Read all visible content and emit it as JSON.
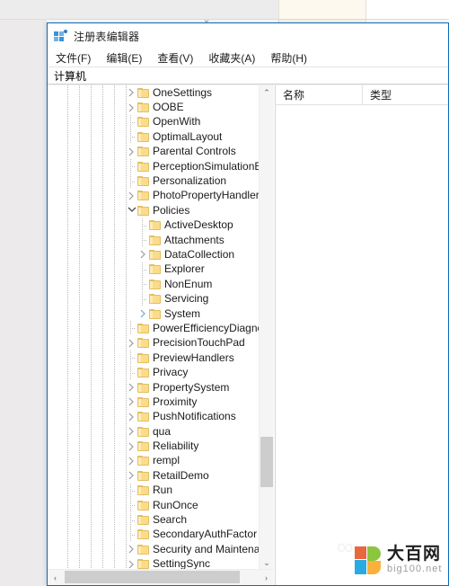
{
  "window": {
    "title": "注册表编辑器",
    "icon": "registry-editor-icon",
    "border_color": "#0a6cbd"
  },
  "menubar": {
    "items": [
      {
        "label": "文件(F)",
        "name": "menu-file"
      },
      {
        "label": "编辑(E)",
        "name": "menu-edit"
      },
      {
        "label": "查看(V)",
        "name": "menu-view"
      },
      {
        "label": "收藏夹(A)",
        "name": "menu-favorites"
      },
      {
        "label": "帮助(H)",
        "name": "menu-help"
      }
    ]
  },
  "address_bar": {
    "value": "计算机"
  },
  "tree": {
    "items": [
      {
        "label": "OneSettings",
        "indent": 6,
        "state": "collapsed"
      },
      {
        "label": "OOBE",
        "indent": 6,
        "state": "collapsed"
      },
      {
        "label": "OpenWith",
        "indent": 6,
        "state": "leaf"
      },
      {
        "label": "OptimalLayout",
        "indent": 6,
        "state": "leaf"
      },
      {
        "label": "Parental Controls",
        "indent": 6,
        "state": "collapsed"
      },
      {
        "label": "PerceptionSimulationExtens",
        "indent": 6,
        "state": "leaf"
      },
      {
        "label": "Personalization",
        "indent": 6,
        "state": "leaf"
      },
      {
        "label": "PhotoPropertyHandler",
        "indent": 6,
        "state": "collapsed"
      },
      {
        "label": "Policies",
        "indent": 6,
        "state": "expanded"
      },
      {
        "label": "ActiveDesktop",
        "indent": 7,
        "state": "leaf"
      },
      {
        "label": "Attachments",
        "indent": 7,
        "state": "leaf"
      },
      {
        "label": "DataCollection",
        "indent": 7,
        "state": "collapsed"
      },
      {
        "label": "Explorer",
        "indent": 7,
        "state": "leaf"
      },
      {
        "label": "NonEnum",
        "indent": 7,
        "state": "leaf"
      },
      {
        "label": "Servicing",
        "indent": 7,
        "state": "leaf"
      },
      {
        "label": "System",
        "indent": 7,
        "state": "collapsed-hover"
      },
      {
        "label": "PowerEfficiencyDiagnostics",
        "indent": 6,
        "state": "leaf"
      },
      {
        "label": "PrecisionTouchPad",
        "indent": 6,
        "state": "collapsed"
      },
      {
        "label": "PreviewHandlers",
        "indent": 6,
        "state": "leaf"
      },
      {
        "label": "Privacy",
        "indent": 6,
        "state": "leaf"
      },
      {
        "label": "PropertySystem",
        "indent": 6,
        "state": "collapsed"
      },
      {
        "label": "Proximity",
        "indent": 6,
        "state": "collapsed"
      },
      {
        "label": "PushNotifications",
        "indent": 6,
        "state": "collapsed"
      },
      {
        "label": "qua",
        "indent": 6,
        "state": "collapsed"
      },
      {
        "label": "Reliability",
        "indent": 6,
        "state": "collapsed"
      },
      {
        "label": "rempl",
        "indent": 6,
        "state": "collapsed"
      },
      {
        "label": "RetailDemo",
        "indent": 6,
        "state": "collapsed"
      },
      {
        "label": "Run",
        "indent": 6,
        "state": "leaf"
      },
      {
        "label": "RunOnce",
        "indent": 6,
        "state": "leaf"
      },
      {
        "label": "Search",
        "indent": 6,
        "state": "leaf"
      },
      {
        "label": "SecondaryAuthFactor",
        "indent": 6,
        "state": "leaf"
      },
      {
        "label": "Security and Maintenance",
        "indent": 6,
        "state": "collapsed"
      },
      {
        "label": "SettingSync",
        "indent": 6,
        "state": "collapsed"
      }
    ],
    "scroll": {
      "up_arrow": "⌃",
      "down_arrow": "⌄",
      "left_arrow": "‹",
      "right_arrow": "›"
    }
  },
  "list_pane": {
    "columns": [
      {
        "label": "名称"
      },
      {
        "label": "类型"
      }
    ],
    "rows": []
  },
  "watermark": {
    "cn": "大百网",
    "en": "big100.net"
  },
  "background": {
    "tab_chevron": "⌄"
  }
}
